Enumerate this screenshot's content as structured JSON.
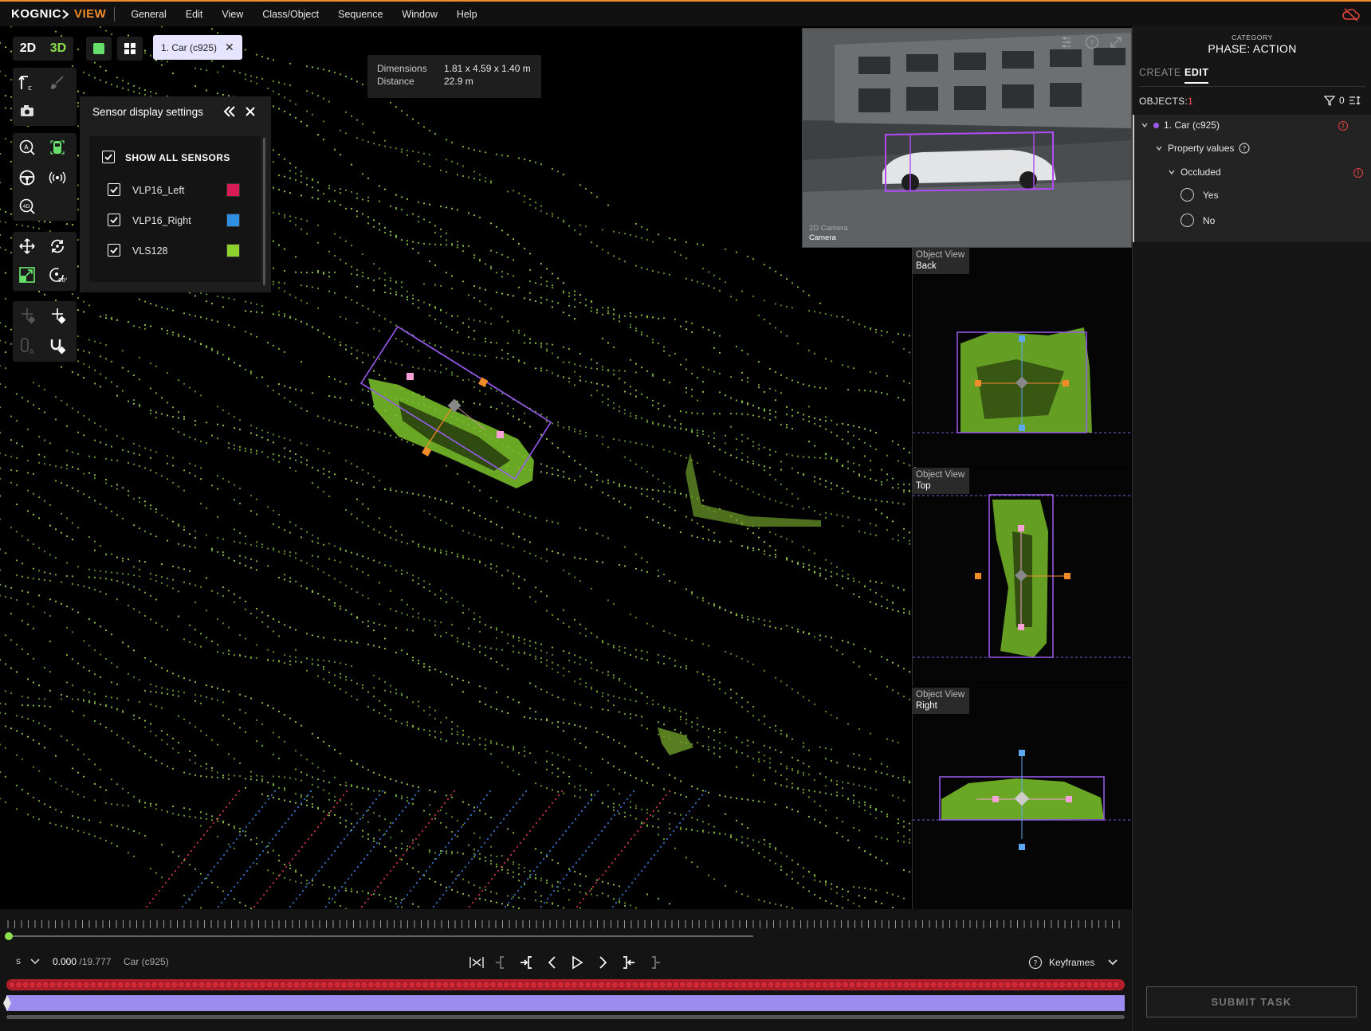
{
  "app": {
    "brand": "KOGNIC",
    "product": "VIEW"
  },
  "menu": [
    "General",
    "Edit",
    "View",
    "Class/Object",
    "Sequence",
    "Window",
    "Help"
  ],
  "view_tabs": {
    "two_d": "2D",
    "three_d": "3D"
  },
  "selected_object_chip": "1. Car (c925)",
  "sensor_panel": {
    "title": "Sensor display settings",
    "show_all": "SHOW ALL SENSORS",
    "sensors": [
      {
        "name": "VLP16_Left",
        "color": "#d81b55"
      },
      {
        "name": "VLP16_Right",
        "color": "#2f8fe0"
      },
      {
        "name": "VLS128",
        "color": "#8ed12f"
      }
    ]
  },
  "dimensions": {
    "dim_label": "Dimensions",
    "dim_value": "1.81 x 4.59 x 1.40 m",
    "dist_label": "Distance",
    "dist_value": "22.9 m"
  },
  "camera": {
    "label_line1": "2D Camera",
    "label_line2": "Camera"
  },
  "object_views": [
    {
      "title": "Object View",
      "side": "Back"
    },
    {
      "title": "Object View",
      "side": "Top"
    },
    {
      "title": "Object View",
      "side": "Right"
    }
  ],
  "sidebar": {
    "category_label": "CATEGORY",
    "phase": "PHASE: ACTION",
    "tabs": [
      "CREATE",
      "EDIT"
    ],
    "objects_label": "OBJECTS:",
    "objects_count": "1",
    "filter_count": "0",
    "tree": {
      "object": "1. Car (c925)",
      "property_values": "Property values",
      "property": "Occluded",
      "options": [
        "Yes",
        "No"
      ]
    },
    "submit": "SUBMIT TASK"
  },
  "timeline": {
    "unit": "s",
    "current_time": "0.000",
    "total_time": "/19.777",
    "object": "Car (c925)",
    "keyframes": "Keyframes"
  },
  "colors": {
    "accent_orange": "#f28c28",
    "lidar_green": "#8ed12f",
    "bbox_purple": "#9b5cf0",
    "warning_red": "#e0443e"
  }
}
